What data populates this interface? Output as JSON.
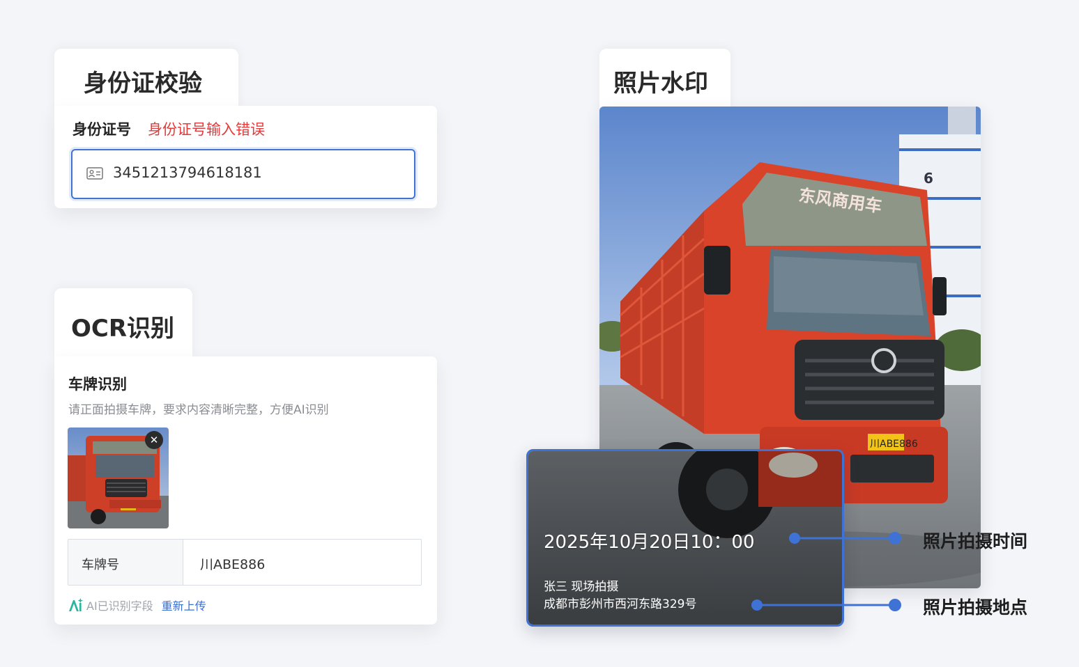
{
  "id_check": {
    "tab_title": "身份证校验",
    "field_label": "身份证号",
    "error_text": "身份证号输入错误",
    "input_value": "3451213794618181",
    "input_icon": "id-card-icon"
  },
  "ocr": {
    "tab_title": "OCR识别",
    "section_title": "车牌识别",
    "hint": "请正面拍摄车牌，要求内容清晰完整，方便AI识别",
    "thumbnail_icon": "truck-photo-thumbnail",
    "remove_icon": "close-icon",
    "remove_glyph": "✕",
    "table": {
      "key": "车牌号",
      "value": "川ABE886"
    },
    "ai_label": "AI已识别字段",
    "reupload_label": "重新上传"
  },
  "watermark": {
    "tab_title": "照片水印",
    "photo_plate": "川ABE886",
    "photo_cab_text": "东风商用车",
    "photo_building_number": "6",
    "time_text": "2025年10月20日10：00",
    "person_text": "张三 现场拍摄",
    "place_text": "成都市彭州市西河东路329号",
    "callout_time_label": "照片拍摄时间",
    "callout_place_label": "照片拍摄地点"
  },
  "colors": {
    "accent": "#3e72d4",
    "error": "#e23b3b",
    "truck_red": "#d9432a",
    "link": "#3a6fd0"
  }
}
